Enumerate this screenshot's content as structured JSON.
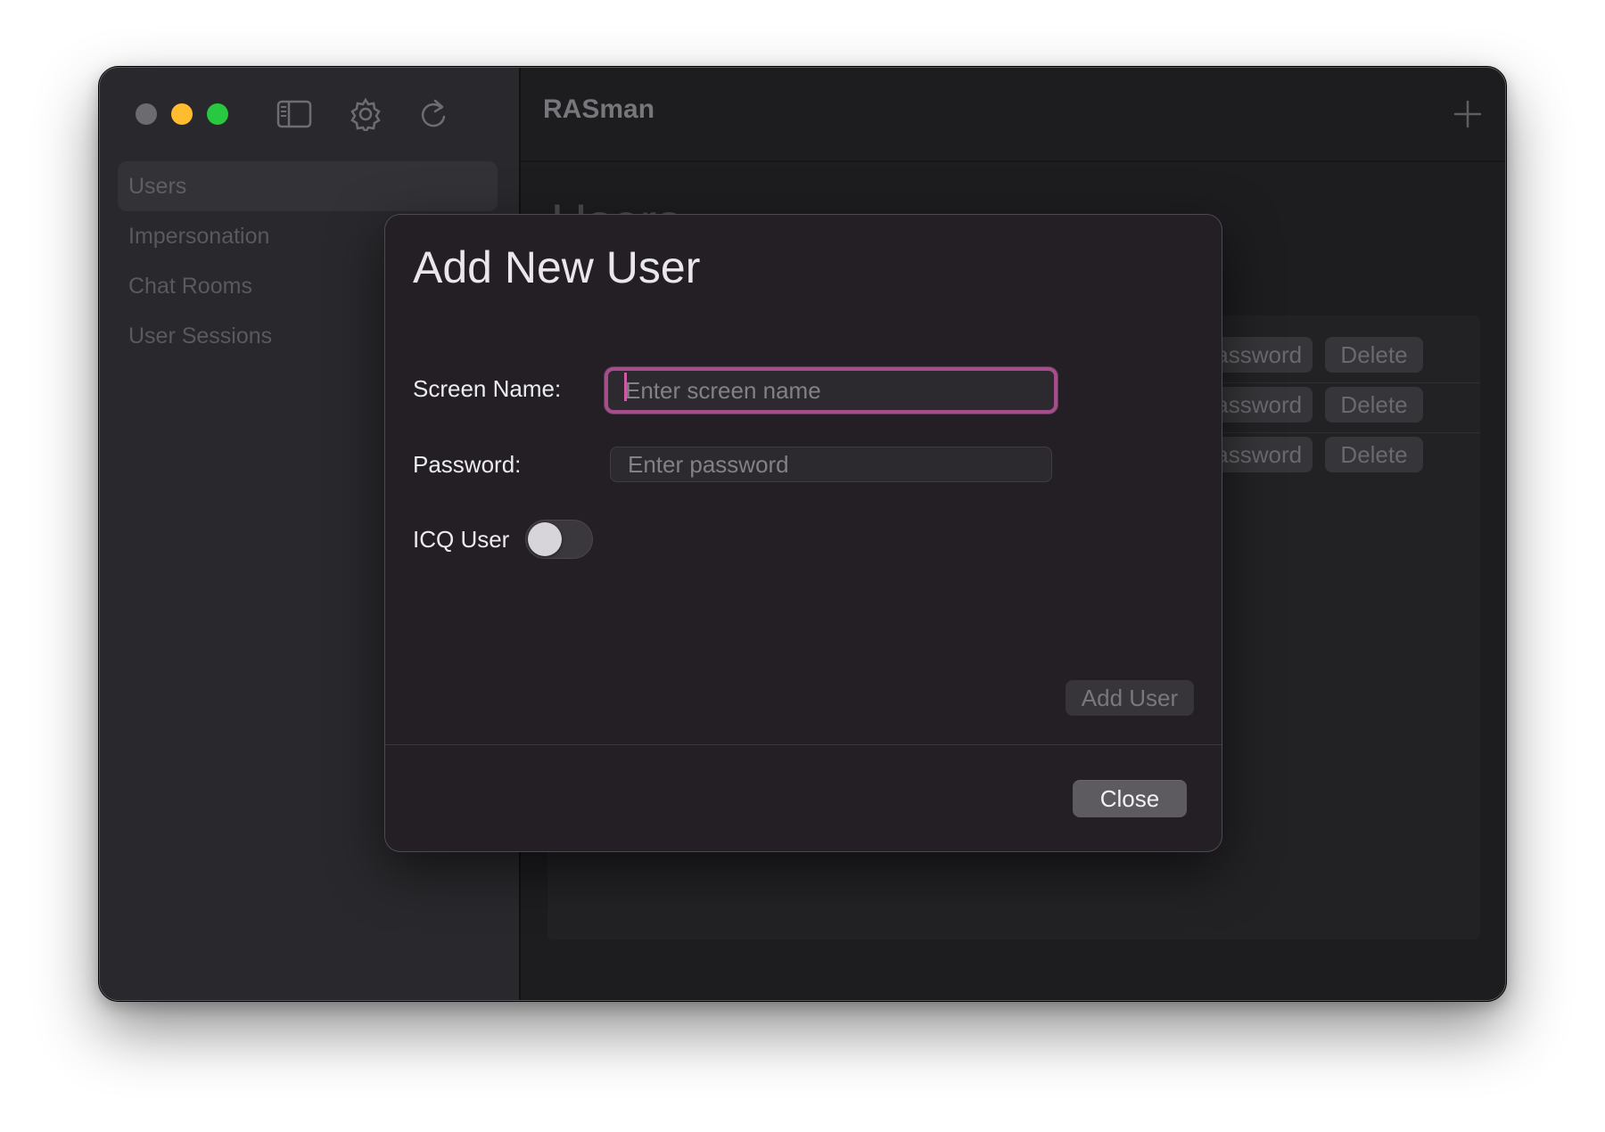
{
  "app": {
    "title": "RASman"
  },
  "toolbar": {
    "icons": [
      "sidebar-toggle-icon",
      "gear-icon",
      "refresh-icon",
      "plus-icon"
    ]
  },
  "sidebar": {
    "items": [
      {
        "label": "Users",
        "active": true
      },
      {
        "label": "Impersonation",
        "active": false
      },
      {
        "label": "Chat Rooms",
        "active": false
      },
      {
        "label": "User Sessions",
        "active": false
      }
    ]
  },
  "main": {
    "heading": "Users",
    "rows": [
      {
        "password_label": "Password",
        "delete_label": "Delete"
      },
      {
        "password_label": "Password",
        "delete_label": "Delete"
      },
      {
        "password_label": "Password",
        "delete_label": "Delete"
      }
    ]
  },
  "modal": {
    "title": "Add New User",
    "screen_name": {
      "label": "Screen Name:",
      "value": "",
      "placeholder": "Enter screen name"
    },
    "password": {
      "label": "Password:",
      "value": "",
      "placeholder": "Enter password"
    },
    "icq_user": {
      "label": "ICQ User",
      "on": false
    },
    "add_user_label": "Add User",
    "close_label": "Close"
  },
  "colors": {
    "accent_focus": "#a64e8c",
    "traffic_close": "#6c6b6f",
    "traffic_minimize": "#febc2e",
    "traffic_maximize": "#28c840"
  }
}
